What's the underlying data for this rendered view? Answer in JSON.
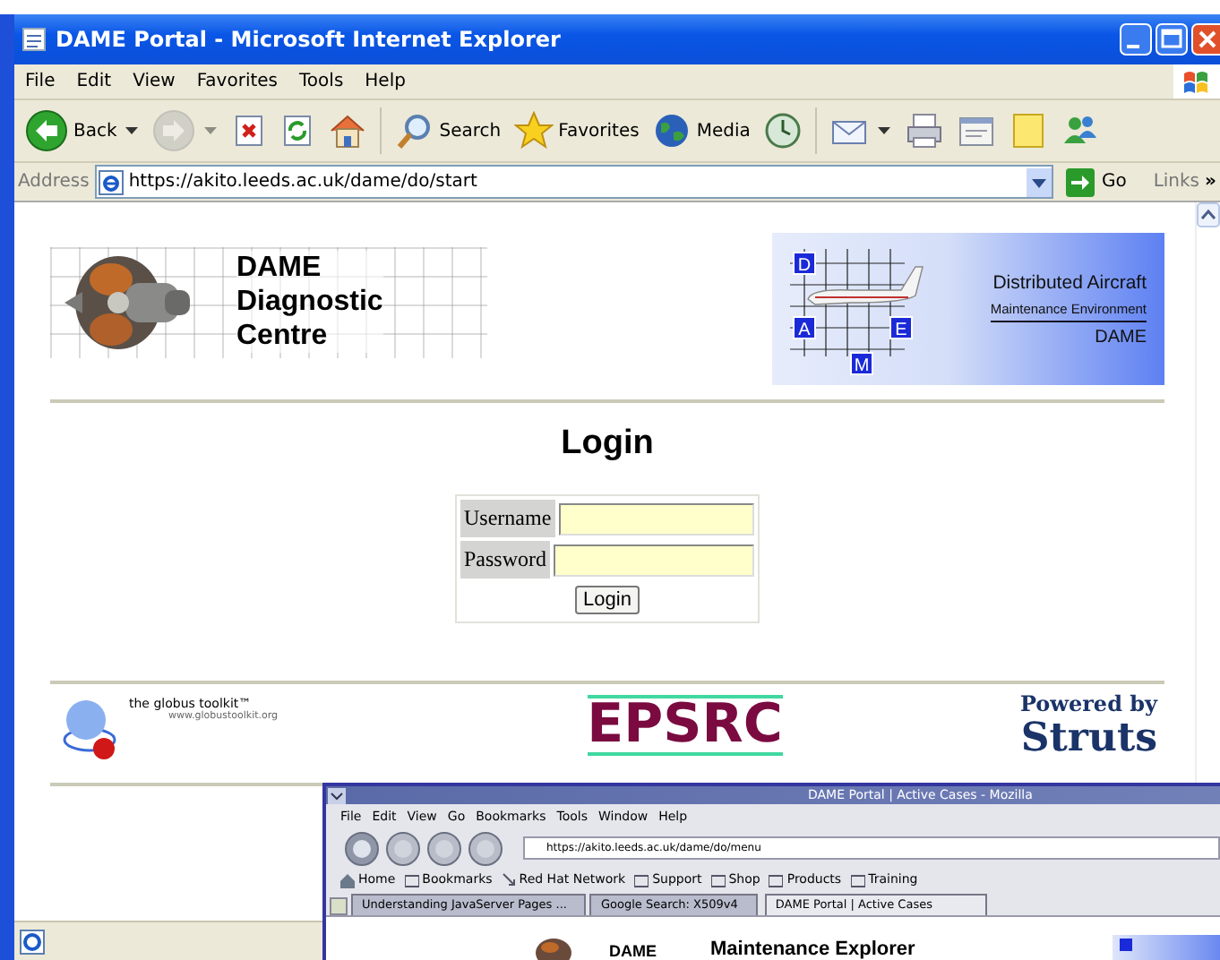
{
  "window": {
    "title": "DAME Portal - Microsoft Internet Explorer"
  },
  "menu": [
    "File",
    "Edit",
    "View",
    "Favorites",
    "Tools",
    "Help"
  ],
  "toolbar": [
    {
      "kind": "back",
      "label": "Back",
      "menu": true,
      "disabled": false
    },
    {
      "kind": "forward",
      "menu": true,
      "disabled": true
    },
    {
      "kind": "stop",
      "menu": false,
      "disabled": false
    },
    {
      "kind": "refresh",
      "menu": false,
      "disabled": false
    },
    {
      "kind": "home",
      "menu": false,
      "disabled": false
    },
    {
      "kind": "separator"
    },
    {
      "kind": "search",
      "label": "Search",
      "menu": false,
      "disabled": false
    },
    {
      "kind": "favorites",
      "label": "Favorites",
      "menu": false,
      "disabled": false
    },
    {
      "kind": "media",
      "label": "Media",
      "menu": false,
      "disabled": false
    },
    {
      "kind": "history",
      "menu": false,
      "disabled": false
    },
    {
      "kind": "separator"
    },
    {
      "kind": "mail",
      "menu": true,
      "disabled": false
    },
    {
      "kind": "print",
      "menu": false,
      "disabled": false
    },
    {
      "kind": "edit",
      "menu": false,
      "disabled": false
    },
    {
      "kind": "note",
      "menu": false,
      "disabled": false
    },
    {
      "kind": "messenger",
      "menu": false,
      "disabled": false
    }
  ],
  "address": {
    "label": "Address",
    "url": "https://akito.leeds.ac.uk/dame/do/start",
    "go": "Go",
    "links": "Links",
    "more": "»"
  },
  "page": {
    "logo": {
      "lines": [
        "DAME",
        "Diagnostic",
        "Centre"
      ]
    },
    "banner": {
      "letters": [
        "D",
        "A",
        "E",
        "M"
      ],
      "lines": [
        "Distributed Aircraft",
        "Maintenance Environment",
        "DAME"
      ]
    },
    "heading": "Login",
    "form": {
      "fields": [
        {
          "label": "Username"
        },
        {
          "label": "Password"
        }
      ],
      "button": "Login"
    },
    "footer": {
      "globus": {
        "name": "the globus toolkit™",
        "url": "www.globustoolkit.org"
      },
      "epsrc": "EPSRC",
      "struts": {
        "caption": "Powered by",
        "name": "Struts"
      }
    }
  },
  "overlay_window": {
    "title": "DAME Portal | Active Cases - Mozilla",
    "menu": [
      "File",
      "Edit",
      "View",
      "Go",
      "Bookmarks",
      "Tools",
      "Window",
      "Help"
    ],
    "url": "https://akito.leeds.ac.uk/dame/do/menu",
    "bookmarks": [
      {
        "kind": "home",
        "label": "Home"
      },
      {
        "kind": "folder",
        "label": "Bookmarks"
      },
      {
        "kind": "link",
        "label": "Red Hat Network"
      },
      {
        "kind": "folder",
        "label": "Support"
      },
      {
        "kind": "folder",
        "label": "Shop"
      },
      {
        "kind": "folder",
        "label": "Products"
      },
      {
        "kind": "folder",
        "label": "Training"
      }
    ],
    "tabs": [
      {
        "label": "Understanding JavaServer Pages ...",
        "selected": false
      },
      {
        "label": "Google Search: X509v4",
        "selected": false
      },
      {
        "label": "DAME Portal | Active Cases",
        "selected": true
      }
    ],
    "page_texts": [
      "DAME",
      "Maintenance Explorer"
    ]
  }
}
